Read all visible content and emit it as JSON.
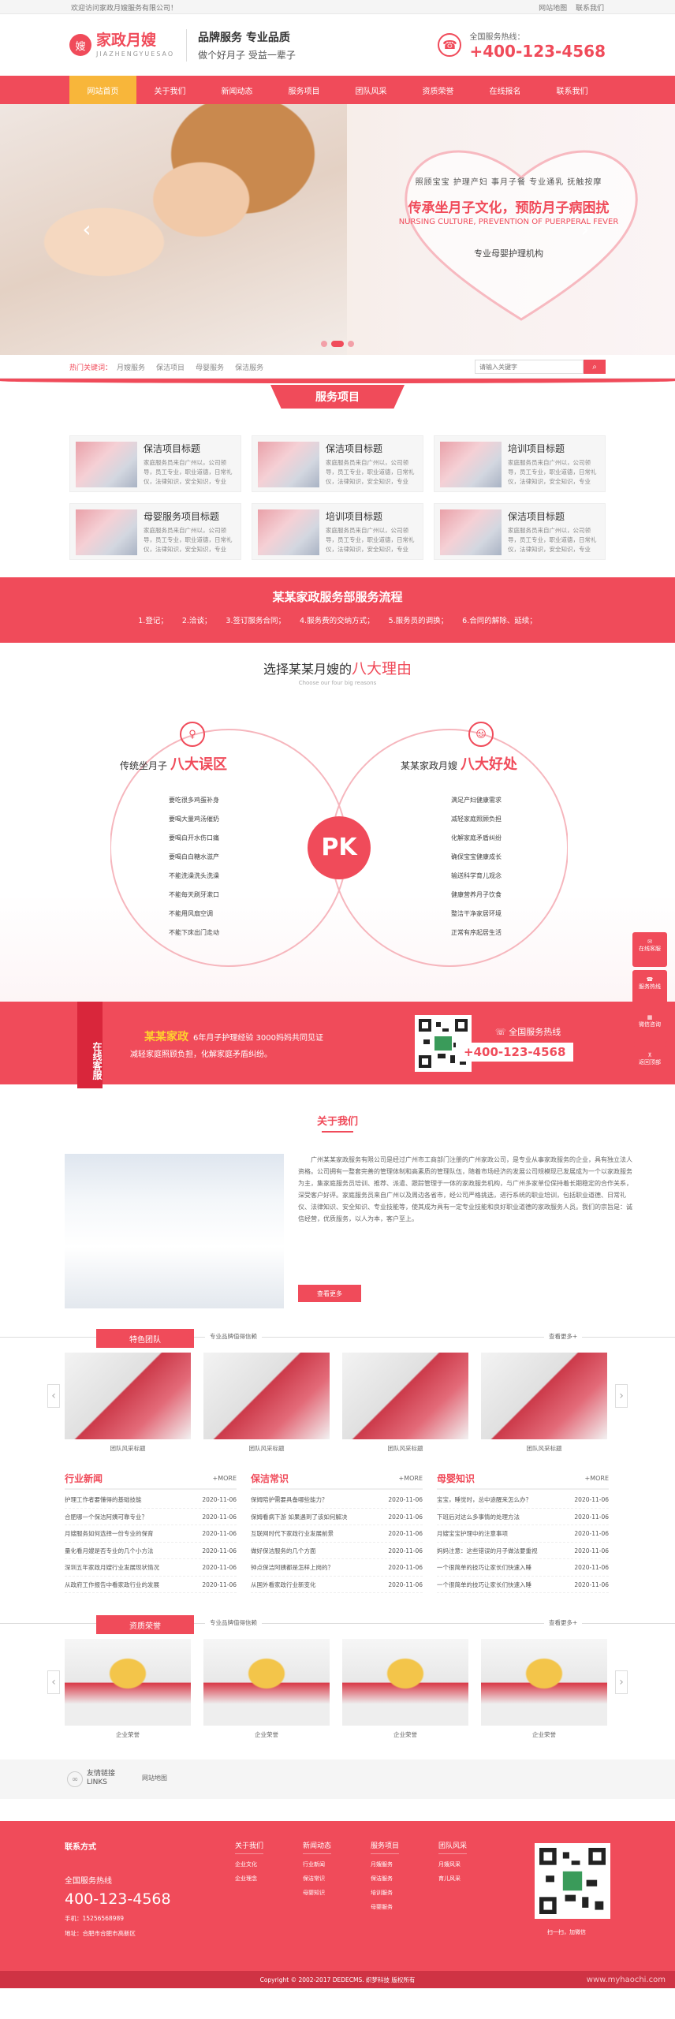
{
  "topbar": {
    "welcome": "欢迎访问家政月嫂服务有限公司！",
    "links": [
      "网站地图",
      "联系我们"
    ]
  },
  "logo": {
    "mark": "嫂",
    "name": "家政月嫂",
    "pinyin": "JIAZHENGYUESAO"
  },
  "slogan": {
    "line1": "品牌服务  专业品质",
    "line2": "做个好月子 受益一辈子"
  },
  "hotline": {
    "label": "全国服务热线：",
    "number": "+400-123-4568"
  },
  "nav": [
    {
      "label": "网站首页",
      "active": true
    },
    {
      "label": "关于我们"
    },
    {
      "label": "新闻动态"
    },
    {
      "label": "服务项目"
    },
    {
      "label": "团队风采"
    },
    {
      "label": "资质荣誉"
    },
    {
      "label": "在线报名"
    },
    {
      "label": "联系我们"
    }
  ],
  "banner": {
    "tags": "照顾宝宝 护理产妇 事月子餐 专业通乳 抚触按摩",
    "headline": "传承坐月子文化，预防月子病困扰",
    "headline_en": "NURSING CULTURE, PREVENTION OF PUERPERAL FEVER",
    "tagline": "专业母婴护理机构",
    "prev": "‹",
    "next": "›"
  },
  "keywords": {
    "label": "热门关键词：",
    "items": [
      "月嫂服务",
      "保洁项目",
      "母婴服务",
      "保洁服务"
    ],
    "search_placeholder": "请输入关键字",
    "search_icon": "search-icon"
  },
  "services": {
    "title": "服务项目",
    "items": [
      {
        "title": "保洁项目标题",
        "desc": "家庭服务员来自广州以，公司领导，员工专业，职业道德，日常礼仪，法律知识，安全知识，专业"
      },
      {
        "title": "保洁项目标题",
        "desc": "家庭服务员来自广州以，公司领导，员工专业，职业道德，日常礼仪，法律知识，安全知识，专业"
      },
      {
        "title": "培训项目标题",
        "desc": "家庭服务员来自广州以，公司领导，员工专业，职业道德，日常礼仪，法律知识，安全知识，专业"
      },
      {
        "title": "母婴服务项目标题",
        "desc": "家庭服务员来自广州以，公司领导，员工专业，职业道德，日常礼仪，法律知识，安全知识，专业"
      },
      {
        "title": "培训项目标题",
        "desc": "家庭服务员来自广州以，公司领导，员工专业，职业道德，日常礼仪，法律知识，安全知识，专业"
      },
      {
        "title": "保洁项目标题",
        "desc": "家庭服务员来自广州以，公司领导，员工专业，职业道德，日常礼仪，法律知识，安全知识，专业"
      }
    ]
  },
  "process": {
    "title": "某某家政服务部服务流程",
    "steps": [
      "1.登记；",
      "2.洽谈；",
      "3.签订服务合同；",
      "4.服务费的交纳方式；",
      "5.服务员的调换；",
      "6.合同的解除、延续；"
    ]
  },
  "reasons": {
    "title_pre": "选择某某月嫂的",
    "title_hl": "八大理由",
    "subtitle": "Choose our four big reasons",
    "left_title": "传统坐月子",
    "left_hl": "八大误区",
    "right_title": "某某家政月嫂",
    "right_hl": "八大好处",
    "left_items": [
      "要吃很多鸡蛋补身",
      "要喝大量鸡汤催奶",
      "要喝白开水伤口痛",
      "要喝白白糖水滋产",
      "不能洗澡洗头洗澡",
      "不能每天刷牙漱口",
      "不能用风扇空调",
      "不能下床出门走动"
    ],
    "right_items": [
      "满足产妇健康需求",
      "减轻家庭照顾负担",
      "化解家庭矛盾纠纷",
      "确保宝宝健康成长",
      "输送科学育儿观念",
      "健康营养月子饮食",
      "整洁干净家居环境",
      "正常有序起居生活"
    ],
    "pk": "PK"
  },
  "cta": {
    "tag": "在线客服",
    "brand": "某某家政",
    "line1": "6年月子护理经验 3000妈妈共同见证",
    "line2": "减轻家庭照顾负担，化解家庭矛盾纠纷。",
    "hot_label": "全国服务热线",
    "hot_number": "+400-123-4568"
  },
  "about": {
    "title": "关于我们",
    "text": "广州某某家政服务有限公司是经过广州市工商部门注册的广州家政公司，是专业从事家政服务的企业，具有独立法人资格。公司拥有一整套完善的管理体制和高素质的管理队伍，随着市场经济的发展公司规模现已发展成为一个以家政服务为主，集家庭服务员培训、推荐、派遣、跟踪管理于一体的家政服务机构，与广州多家单位保持着长期稳定的合作关系，深受客户好评。家庭服务员来自广州以及周边各省市，经公司严格挑选，进行系统的职业培训，包括职业道德、日常礼仪、法律知识、安全知识、专业技能等，使其成为具有一定专业技能和良好职业道德的家政服务人员。我们的宗旨是：诚信经营，优质服务，以人为本，客户至上。",
    "more": "查看更多"
  },
  "team": {
    "label": "特色团队",
    "sub": "专业品牌值得信赖",
    "more": "查看更多+",
    "items": [
      "团队风采标题",
      "团队风采标题",
      "团队风采标题",
      "团队风采标题"
    ]
  },
  "news": [
    {
      "title": "行业新闻",
      "more": "+MORE",
      "rows": [
        [
          "护理工作者要懂得的基础技能",
          "2020-11-06"
        ],
        [
          "合肥哪一个保洁阿姨可靠专业？",
          "2020-11-06"
        ],
        [
          "月嫂服务如何选择一份专业的保育",
          "2020-11-06"
        ],
        [
          "量化看月嫂是否专业的几个小方法",
          "2020-11-06"
        ],
        [
          "深圳五年家政月嫂行业发展现状情况",
          "2020-11-06"
        ],
        [
          "从政府工作报告中看家政行业的发展",
          "2020-11-06"
        ]
      ]
    },
    {
      "title": "保洁常识",
      "more": "+MORE",
      "rows": [
        [
          "保姆陪护需要具备哪些能力？",
          "2020-11-06"
        ],
        [
          "保姆看病下游 如果遇到了该如何解决",
          "2020-11-06"
        ],
        [
          "互联网时代下家政行业发展前景",
          "2020-11-06"
        ],
        [
          "做好保洁服务的几个方面",
          "2020-11-06"
        ],
        [
          "钟点保洁阿姨都是怎样上岗的？",
          "2020-11-06"
        ],
        [
          "从国外看家政行业新变化",
          "2020-11-06"
        ]
      ]
    },
    {
      "title": "母婴知识",
      "more": "+MORE",
      "rows": [
        [
          "宝宝，睡觉时，总中途醒来怎么办？",
          "2020-11-06"
        ],
        [
          "下班后对这么多事情的处理方法",
          "2020-11-06"
        ],
        [
          "月嫂宝宝护理中的注意事项",
          "2020-11-06"
        ],
        [
          "妈妈注意：这些错误的月子做法要重视",
          "2020-11-06"
        ],
        [
          "一个很简单的技巧让家长们快速入睡",
          "2020-11-06"
        ],
        [
          "一个很简单的技巧让家长们快速入睡",
          "2020-11-06"
        ]
      ]
    }
  ],
  "honor": {
    "label": "资质荣誉",
    "sub": "专业品牌值得信赖",
    "more": "查看更多+",
    "items": [
      "企业荣誉",
      "企业荣誉",
      "企业荣誉",
      "企业荣誉"
    ]
  },
  "friends": {
    "title": "友情链接",
    "sub": "LINKS",
    "links": [
      "网站地图"
    ]
  },
  "footer": {
    "contact_title": "联系方式",
    "hot_label": "全国服务热线",
    "hot_number": "400-123-4568",
    "phone": "手机：15256568989",
    "address": "地址：合肥市合肥市高新区",
    "cols": [
      {
        "title": "关于我们",
        "items": [
          "企业文化",
          "企业理念"
        ]
      },
      {
        "title": "新闻动态",
        "items": [
          "行业新闻",
          "保洁常识",
          "母婴知识"
        ]
      },
      {
        "title": "服务项目",
        "items": [
          "月嫂服务",
          "保洁服务",
          "培训服务",
          "母婴服务"
        ]
      },
      {
        "title": "团队风采",
        "items": [
          "月嫂风采",
          "育儿风采"
        ]
      }
    ],
    "qr_label": "扫一扫，加微信",
    "copyright": "Copyright © 2002-2017 DEDECMS. 织梦科技 版权所有",
    "watermark": "www.myhaochi.com"
  },
  "float": [
    "在线客服",
    "服务热线",
    "微信咨询",
    "返回顶部"
  ],
  "colors": {
    "brand": "#f04b5a",
    "accent": "#f8b63a",
    "highlight": "#ffd22e"
  }
}
